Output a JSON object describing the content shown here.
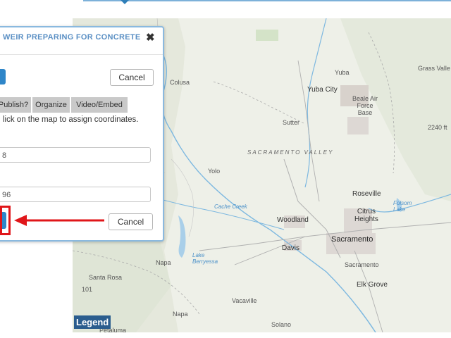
{
  "dialog": {
    "title": "WEIR PREPARING FOR CONCRETE",
    "close_symbol": "✖",
    "top_cancel_label": "Cancel",
    "bottom_cancel_label": "Cancel",
    "tabs": [
      "Publish?",
      "Organize",
      "Video/Embed"
    ],
    "hint": "lick on the map to assign coordinates.",
    "field1_value": "8",
    "field2_value": "96"
  },
  "map": {
    "legend_label": "Legend",
    "labels": {
      "grass_valley": "Grass Valle",
      "yuba": "Yuba",
      "yuba_city": "Yuba City",
      "beale": [
        "Beale Air",
        "Force",
        "Base"
      ],
      "colusa": "Colusa",
      "sutter": "Sutter",
      "sacramento_valley": "SACRAMENTO VALLEY",
      "yolo": "Yolo",
      "roseville": "Roseville",
      "cache_creek": "Cache Creek",
      "citrus_heights": [
        "Citrus",
        "Heights"
      ],
      "folsom_lake": [
        "Folsom",
        "Lake"
      ],
      "woodland": "Woodland",
      "sacramento": "Sacramento",
      "davis": "Davis",
      "lake_berryessa": [
        "Lake",
        "Berryessa"
      ],
      "napa_county": "Napa",
      "sacramento_county": "Sacramento",
      "santa_rosa": "Santa Rosa",
      "elk_grove": "Elk Grove",
      "vacaville": "Vacaville",
      "napa": "Napa",
      "solano": "Solano",
      "petaluma": "Petaluma",
      "elevation": "2240 ft",
      "route_101": "101"
    }
  },
  "colors": {
    "accent_blue": "#2f86c9",
    "highlight_red": "#e0161a",
    "title_blue": "#5a8fc4",
    "legend_bg": "#2b5d8e"
  }
}
